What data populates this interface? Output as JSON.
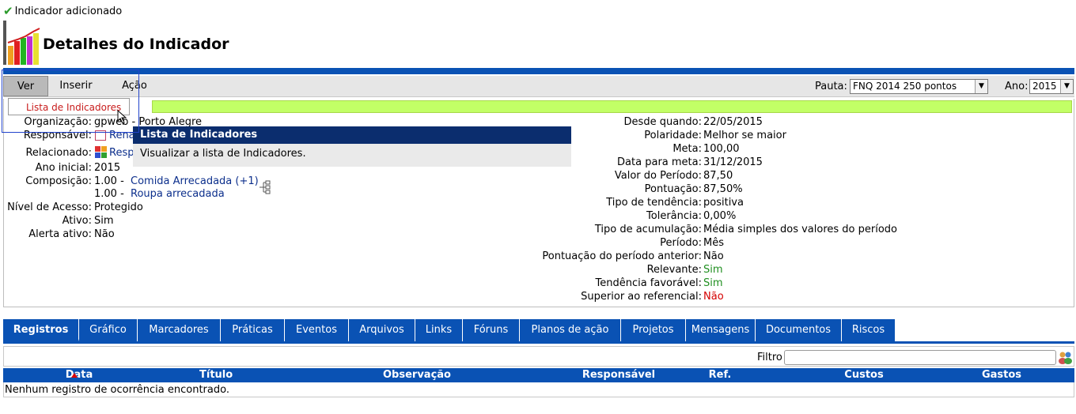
{
  "notice": {
    "text": "Indicador adicionado"
  },
  "header": {
    "title": "Detalhes do Indicador"
  },
  "toolbar": {
    "menu_ver": "Ver",
    "menu_inserir": "Inserir",
    "menu_acao": "Ação",
    "pauta_label": "Pauta:",
    "pauta_value": "FNQ 2014 250 pontos",
    "ano_label": "Ano:",
    "ano_value": "2015"
  },
  "dropdown": {
    "item": "Lista de Indicadores"
  },
  "tooltip": {
    "title": "Lista de Indicadores",
    "body": "Visualizar a lista de Indicadores."
  },
  "details_left": {
    "organizacao_label": "Organização:",
    "organizacao_value": "gpweb - Porto Alegre",
    "responsavel_label": "Responsável:",
    "responsavel_value": "Rena",
    "relacionado_label": "Relacionado:",
    "relacionado_value": "Respo",
    "ano_inicial_label": "Ano inicial:",
    "ano_inicial_value": "2015",
    "composicao_label": "Composição:",
    "composicao_items": [
      {
        "weight": "1.00 -",
        "name": "Comida Arrecadada (+1)"
      },
      {
        "weight": "1.00 -",
        "name": "Roupa arrecadada"
      }
    ],
    "nivel_label": "Nível de Acesso:",
    "nivel_value": "Protegido",
    "ativo_label": "Ativo:",
    "ativo_value": "Sim",
    "alerta_label": "Alerta ativo:",
    "alerta_value": "Não"
  },
  "details_right": [
    {
      "label": "Desde quando:",
      "value": "22/05/2015",
      "color": "#000000"
    },
    {
      "label": "Polaridade:",
      "value": "Melhor se maior",
      "color": "#000000"
    },
    {
      "label": "Meta:",
      "value": "100,00",
      "color": "#000000"
    },
    {
      "label": "Data para meta:",
      "value": "31/12/2015",
      "color": "#000000"
    },
    {
      "label": "Valor do Período:",
      "value": "87,50",
      "color": "#000000"
    },
    {
      "label": "Pontuação:",
      "value": "87,50%",
      "color": "#000000"
    },
    {
      "label": "Tipo de tendência:",
      "value": "positiva",
      "color": "#000000"
    },
    {
      "label": "Tolerância:",
      "value": "0,00%",
      "color": "#000000"
    },
    {
      "label": "Tipo de acumulação:",
      "value": "Média simples dos valores do período",
      "color": "#000000"
    },
    {
      "label": "Período:",
      "value": "Mês",
      "color": "#000000"
    },
    {
      "label": "Pontuação do período anterior:",
      "value": "Não",
      "color": "#000000"
    },
    {
      "label": "Relevante:",
      "value": "Sim",
      "color": "#1f8f1f"
    },
    {
      "label": "Tendência favorável:",
      "value": "Sim",
      "color": "#1f8f1f"
    },
    {
      "label": "Superior ao referencial:",
      "value": "Não",
      "color": "#d40000"
    }
  ],
  "tabs": [
    "Registros",
    "Gráfico",
    "Marcadores",
    "Práticas",
    "Eventos",
    "Arquivos",
    "Links",
    "Fóruns",
    "Planos de ação",
    "Projetos",
    "Mensagens",
    "Documentos",
    "Riscos"
  ],
  "filter": {
    "label": "Filtro"
  },
  "table": {
    "columns": [
      "Data",
      "Título",
      "Observação",
      "Responsável",
      "Ref.",
      "Custos",
      "Gastos"
    ],
    "empty_message": "Nenhum registro de ocorrência encontrado."
  }
}
